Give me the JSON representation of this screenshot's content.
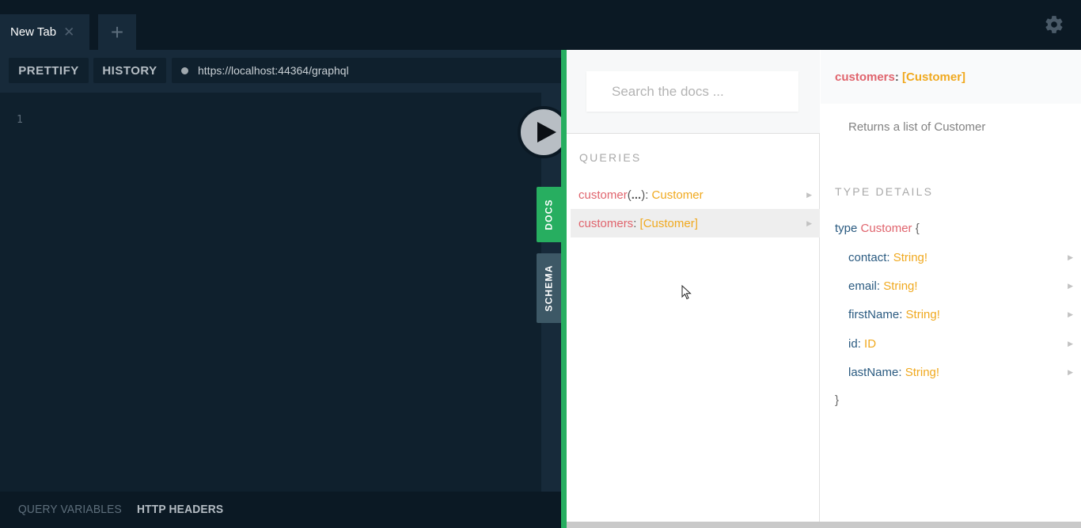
{
  "tabs": [
    {
      "label": "New Tab",
      "close_icon": "close-icon"
    }
  ],
  "add_tab_icon": "+",
  "toolbar": {
    "prettify_label": "PRETTIFY",
    "history_label": "HISTORY",
    "url": "https://localhost:44364/graphql"
  },
  "editor": {
    "line_numbers": [
      "1"
    ]
  },
  "bottom_tabs": {
    "query_variables": "QUERY VARIABLES",
    "http_headers": "HTTP HEADERS"
  },
  "side_tabs": {
    "docs": "DOCS",
    "schema": "SCHEMA"
  },
  "docs": {
    "search_placeholder": "Search the docs ...",
    "queries_title": "QUERIES",
    "queries": [
      {
        "name": "customer",
        "args": "...",
        "type": "Customer",
        "active": false
      },
      {
        "name": "customers",
        "args": "",
        "type": "[Customer]",
        "active": true
      }
    ],
    "detail": {
      "field_name": "customers",
      "field_type": "[Customer]",
      "description": "Returns a list of Customer",
      "type_details_title": "TYPE DETAILS",
      "type_keyword": "type",
      "type_name": "Customer",
      "open_brace": "{",
      "close_brace": "}",
      "fields": [
        {
          "name": "contact",
          "type": "String!"
        },
        {
          "name": "email",
          "type": "String!"
        },
        {
          "name": "firstName",
          "type": "String!"
        },
        {
          "name": "id",
          "type": "ID"
        },
        {
          "name": "lastName",
          "type": "String!"
        }
      ]
    }
  },
  "colors": {
    "accent_green": "#27ae60",
    "field_name": "#e0646d",
    "type_name": "#f0a91f",
    "keyword": "#2a5a80"
  }
}
